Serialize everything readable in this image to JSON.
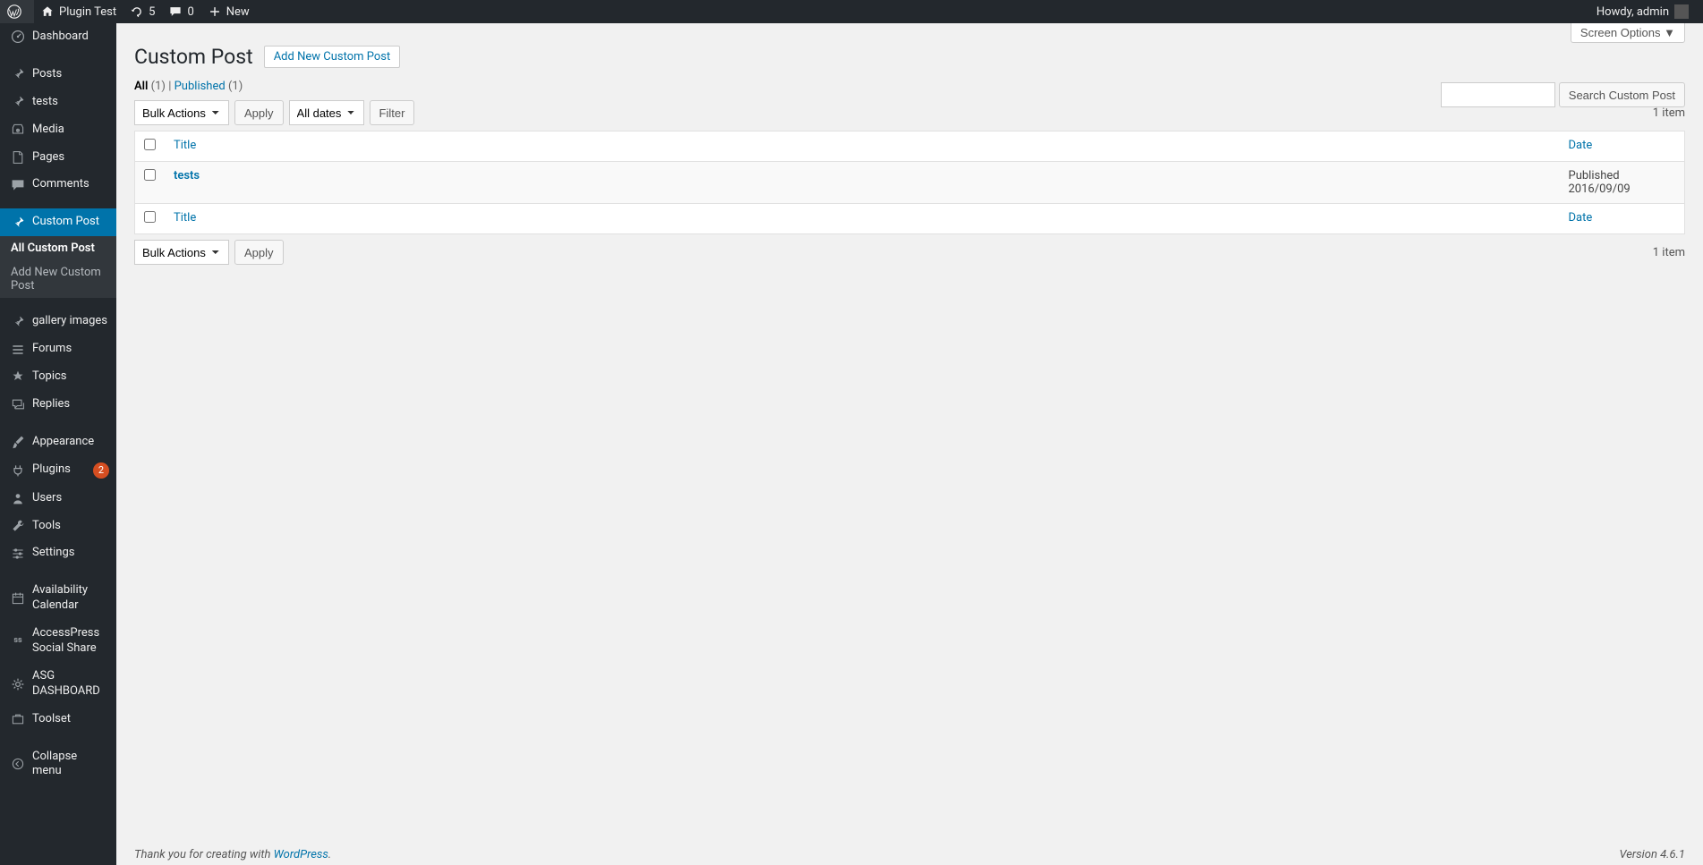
{
  "toolbar": {
    "siteName": "Plugin Test",
    "updatesCount": "5",
    "commentsCount": "0",
    "newLabel": "New",
    "howdy": "Howdy, admin"
  },
  "sidebar": {
    "items": [
      {
        "label": "Dashboard",
        "icon": "dashboard"
      },
      {
        "label": "Posts",
        "icon": "pin"
      },
      {
        "label": "tests",
        "icon": "pin"
      },
      {
        "label": "Media",
        "icon": "media"
      },
      {
        "label": "Pages",
        "icon": "page"
      },
      {
        "label": "Comments",
        "icon": "comment"
      },
      {
        "label": "Custom Post",
        "icon": "pin",
        "current": true
      },
      {
        "label": "gallery images",
        "icon": "pin"
      },
      {
        "label": "Forums",
        "icon": "forums"
      },
      {
        "label": "Topics",
        "icon": "topics"
      },
      {
        "label": "Replies",
        "icon": "replies"
      },
      {
        "label": "Appearance",
        "icon": "brush"
      },
      {
        "label": "Plugins",
        "icon": "plug",
        "badge": "2"
      },
      {
        "label": "Users",
        "icon": "user"
      },
      {
        "label": "Tools",
        "icon": "wrench"
      },
      {
        "label": "Settings",
        "icon": "sliders"
      },
      {
        "label": "Availability Calendar",
        "icon": "calendar"
      },
      {
        "label": "AccessPress Social Share",
        "icon": "ss"
      },
      {
        "label": "ASG DASHBOARD",
        "icon": "gear"
      },
      {
        "label": "Toolset",
        "icon": "toolset"
      }
    ],
    "submenu": {
      "allLabel": "All Custom Post",
      "addNewLabel": "Add New Custom Post"
    },
    "collapseLabel": "Collapse menu"
  },
  "main": {
    "screenOptionsLabel": "Screen Options",
    "pageTitle": "Custom Post",
    "addNewLabel": "Add New Custom Post",
    "filters": {
      "allLabel": "All",
      "allCount": "(1)",
      "publishedLabel": "Published",
      "publishedCount": "(1)"
    },
    "search": {
      "buttonLabel": "Search Custom Post"
    },
    "bulkActions": {
      "label": "Bulk Actions",
      "applyLabel": "Apply"
    },
    "dateFilter": {
      "allDatesLabel": "All dates",
      "filterLabel": "Filter"
    },
    "itemCount": "1 item",
    "table": {
      "titleHeader": "Title",
      "dateHeader": "Date",
      "rows": [
        {
          "title": "tests",
          "status": "Published",
          "date": "2016/09/09"
        }
      ]
    }
  },
  "footer": {
    "thankYouPrefix": "Thank you for creating with ",
    "wpLink": "WordPress",
    "thankYouSuffix": ".",
    "version": "Version 4.6.1"
  }
}
